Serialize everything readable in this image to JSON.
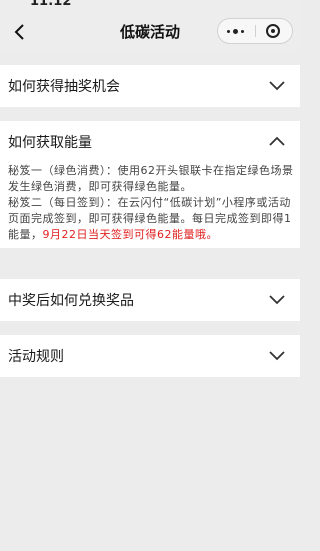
{
  "status_bar": {
    "time": "11:12"
  },
  "nav": {
    "title": "低碳活动"
  },
  "sections": [
    {
      "title": "如何获得抽奖机会",
      "expanded": false
    },
    {
      "title": "如何获取能量",
      "expanded": true,
      "paragraphs": [
        {
          "text": "秘笈一（绿色消费）：使用62开头银联卡在指定绿色场景发生绿色消费，即可获得绿色能量。"
        },
        {
          "text": "秘笈二（每日签到）：在云闪付“低碳计划”小程序或活动页面完成签到，即可获得绿色能量。每日完成签到即得1能量，",
          "highlight": "9月22日当天签到可得62能量哦。"
        }
      ]
    },
    {
      "title": "中奖后如何兑换奖品",
      "expanded": false
    },
    {
      "title": "活动规则",
      "expanded": false
    }
  ],
  "colors": {
    "background": "#ececec",
    "card": "#ffffff",
    "highlight": "#e02020"
  },
  "icons": {
    "back": "chevron-left-icon",
    "more": "more-dots-icon",
    "close": "close-mini-program-icon",
    "collapsed": "chevron-down-icon",
    "expanded": "chevron-up-icon"
  }
}
